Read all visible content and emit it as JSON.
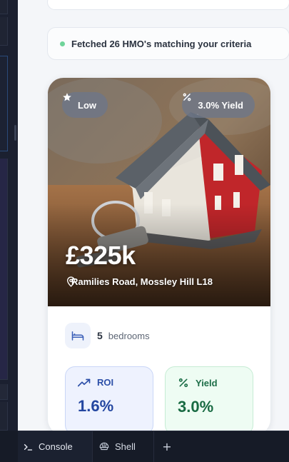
{
  "status": {
    "message": "Fetched 26 HMO's matching your criteria",
    "dot_color": "#6fd49a"
  },
  "listing": {
    "badge_left": {
      "label": "Low",
      "icon": "star-icon"
    },
    "badge_right": {
      "label": "3.0% Yield",
      "icon": "percent-icon"
    },
    "price": "£325k",
    "address": "Ramilies Road, Mossley Hill L18",
    "address_icon": "map-pin-icon",
    "bedrooms": {
      "count": "5",
      "label": "bedrooms",
      "icon": "bed-icon"
    },
    "roi": {
      "label": "ROI",
      "value": "1.6%",
      "icon": "trending-up-icon",
      "color": "#2346a0"
    },
    "yield": {
      "label": "Yield",
      "value": "3.0%",
      "icon": "percent-icon",
      "color": "#186a42"
    }
  },
  "terminal": {
    "tabs": [
      {
        "label": "Console",
        "icon": "terminal-prompt-icon"
      },
      {
        "label": "Shell",
        "icon": "shell-icon"
      }
    ],
    "add_label": "+"
  }
}
